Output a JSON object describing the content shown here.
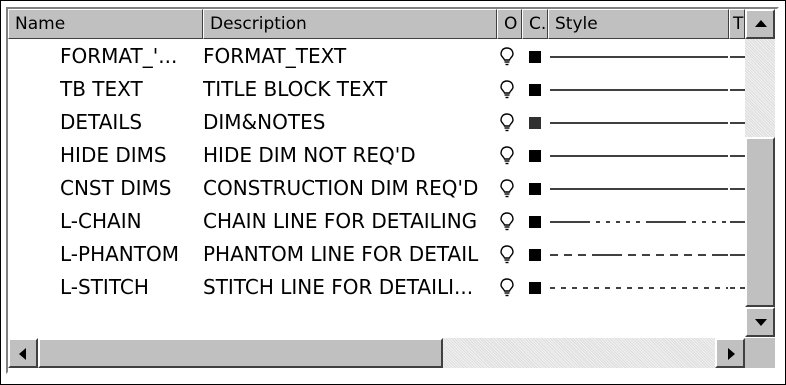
{
  "columns": [
    "Name",
    "Description",
    "O",
    "C.",
    "Style",
    "T"
  ],
  "rows": [
    {
      "name": "FORMAT_'...",
      "description": "FORMAT_TEXT",
      "style": "continuous",
      "color": "#000000"
    },
    {
      "name": "TB TEXT",
      "description": "TITLE BLOCK TEXT",
      "style": "continuous",
      "color": "#000000"
    },
    {
      "name": "DETAILS",
      "description": "DIM&NOTES",
      "style": "continuous",
      "color": "#303030"
    },
    {
      "name": "HIDE DIMS",
      "description": "HIDE DIM NOT REQ'D",
      "style": "continuous",
      "color": "#000000"
    },
    {
      "name": "CNST DIMS",
      "description": "CONSTRUCTION DIM REQ'D",
      "style": "continuous",
      "color": "#000000"
    },
    {
      "name": "L-CHAIN",
      "description": "CHAIN LINE FOR DETAILING",
      "style": "chain",
      "color": "#000000"
    },
    {
      "name": "L-PHANTOM",
      "description": "PHANTOM LINE FOR DETAIL",
      "style": "phantom",
      "color": "#000000"
    },
    {
      "name": "L-STITCH",
      "description": "STITCH LINE FOR DETAILI...",
      "style": "stitch",
      "color": "#000000"
    }
  ],
  "icons": {
    "on_state": "lightbulb-icon",
    "scroll_up": "arrow-up-icon",
    "scroll_down": "arrow-down-icon",
    "scroll_left": "arrow-left-icon",
    "scroll_right": "arrow-right-icon"
  }
}
